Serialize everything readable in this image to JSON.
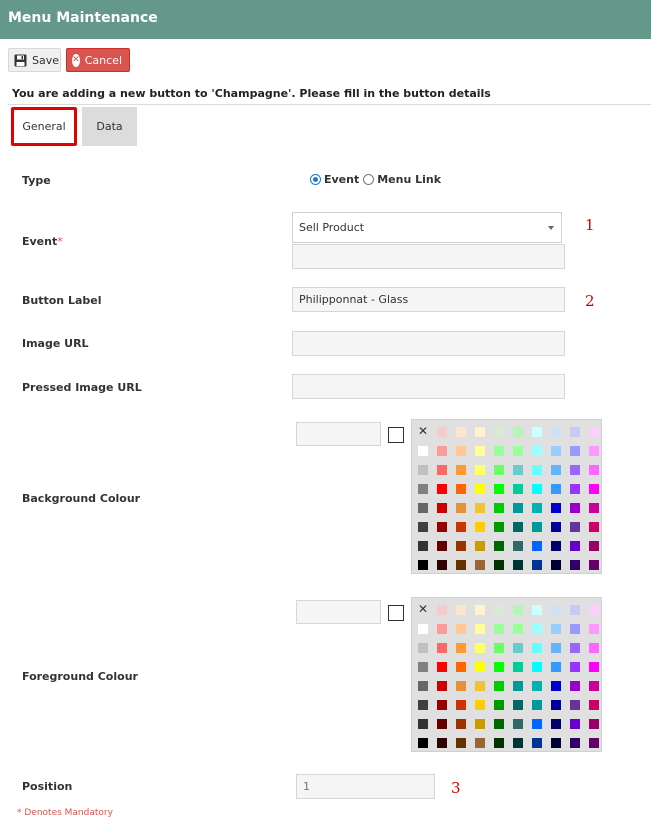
{
  "window": {
    "title": "Menu Maintenance"
  },
  "toolbar": {
    "save_label": "Save",
    "cancel_label": "Cancel"
  },
  "notice": "You are adding a new button to 'Champagne'. Please fill in the button details",
  "tabs": [
    {
      "label": "General",
      "active": true
    },
    {
      "label": "Data",
      "active": false
    }
  ],
  "form": {
    "type": {
      "label": "Type",
      "options": [
        "Event",
        "Menu Link"
      ],
      "selected": "Event"
    },
    "event": {
      "label": "Event",
      "required_mark": "*",
      "value": "Sell Product",
      "secondary_value": ""
    },
    "button_label": {
      "label": "Button Label",
      "value": "Philipponnat - Glass"
    },
    "image_url": {
      "label": "Image URL",
      "value": ""
    },
    "pressed_image_url": {
      "label": "Pressed Image URL",
      "value": ""
    },
    "background_colour": {
      "label": "Background Colour",
      "value": ""
    },
    "foreground_colour": {
      "label": "Foreground Colour",
      "value": ""
    },
    "position": {
      "label": "Position",
      "value": "1"
    }
  },
  "markers": [
    "1",
    "2",
    "3"
  ],
  "footer": {
    "mandatory_note": "* Denotes Mandatory"
  },
  "palette": {
    "none_symbol": "✕",
    "rows": [
      [
        null,
        "#f4cccc",
        "#fce5cd",
        "#fff2cc",
        "#d9ead3",
        "#b6f5b6",
        "#ccffff",
        "#cfe2f3",
        "#c9c9f5",
        "#fccffc"
      ],
      [
        "#ffffff",
        "#ff9a9a",
        "#ffc895",
        "#ffff99",
        "#99ff99",
        "#99ff99",
        "#99ffff",
        "#99ccff",
        "#9999ff",
        "#ff99ff"
      ],
      [
        "#c0c0c0",
        "#ff6666",
        "#ff9933",
        "#ffff66",
        "#66ff66",
        "#66cccc",
        "#66ffff",
        "#66b3ff",
        "#9966ff",
        "#ff66ff"
      ],
      [
        "#808080",
        "#ff0000",
        "#ff6600",
        "#ffff00",
        "#00ff00",
        "#00cc99",
        "#00ffff",
        "#3399ff",
        "#9933ff",
        "#ff00ff"
      ],
      [
        "#666666",
        "#cc0000",
        "#e69138",
        "#f1c232",
        "#00cc00",
        "#009999",
        "#00b2b2",
        "#0000cc",
        "#9900cc",
        "#cc0099"
      ],
      [
        "#404040",
        "#990000",
        "#cc3300",
        "#ffcc00",
        "#009900",
        "#006666",
        "#009999",
        "#000099",
        "#663399",
        "#cc0066"
      ],
      [
        "#333333",
        "#660000",
        "#993300",
        "#cc9900",
        "#006600",
        "#336666",
        "#0066ff",
        "#000066",
        "#6600cc",
        "#990066"
      ],
      [
        "#000000",
        "#330000",
        "#663300",
        "#996633",
        "#003300",
        "#003333",
        "#003399",
        "#000033",
        "#330066",
        "#660066"
      ]
    ]
  }
}
